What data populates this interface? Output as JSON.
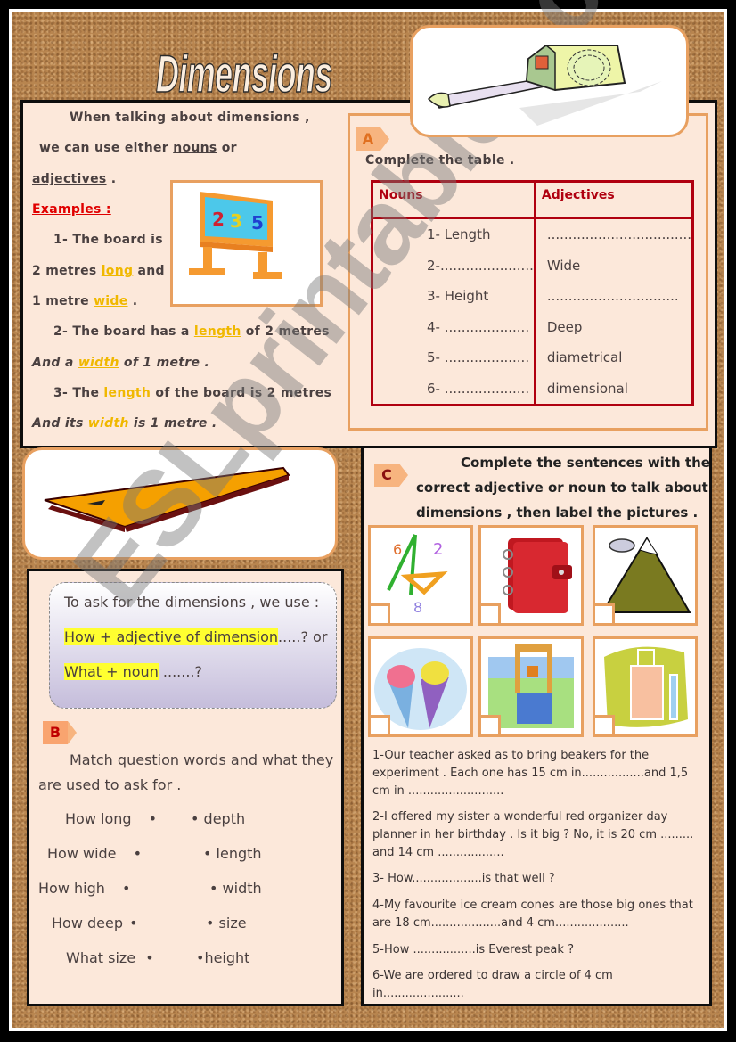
{
  "title": "Dimensions",
  "intro": {
    "line1": "When talking about dimensions ,",
    "line2_pre": "we can use either ",
    "line2_noun": "nouns",
    "line2_post": " or",
    "line3_adj": "adjectives",
    "line3_post": " .",
    "examples_label": "Examples :",
    "ex1_a": "1- The board is",
    "ex1_b_pre": "2 metres ",
    "ex1_b_kw": "long",
    "ex1_b_post": " and",
    "ex1_c_pre": "1 metre ",
    "ex1_c_kw": "wide",
    "ex1_c_post": " .",
    "ex2_a_pre": "2- The board has a ",
    "ex2_a_kw": "length",
    "ex2_a_post": " of 2 metres",
    "ex2_b_pre": "And a ",
    "ex2_b_kw": "width",
    "ex2_b_post": " of 1 metre .",
    "ex3_a_pre": "3- The ",
    "ex3_a_kw": "length",
    "ex3_a_post": " of the board is 2 metres",
    "ex3_b_pre": "And its ",
    "ex3_b_kw": "width",
    "ex3_b_post": " is 1 metre ."
  },
  "sectionA": {
    "tag": "A",
    "instruction": "Complete the table .",
    "headers": [
      "Nouns",
      "Adjectives"
    ],
    "nouns": [
      "1-  Length",
      "2-......................",
      "3-  Height",
      "4-  ....................",
      "5-  ....................",
      "6-  ...................."
    ],
    "adjectives": [
      "..................................",
      "Wide",
      "...............................",
      "Deep",
      "diametrical",
      "dimensional"
    ]
  },
  "sectionB": {
    "bubble_line1": "To ask for the dimensions , we use :",
    "bubble_line2_hl": "How + adjective of dimension",
    "bubble_line2_post": ".....?  or",
    "bubble_line3_hl": "What + noun",
    "bubble_line3_post": " .......?",
    "tag": "B",
    "instruction_line1": "Match question words and what they",
    "instruction_line2": "are used to ask for .",
    "left": [
      "How long",
      "How wide",
      "How high",
      "How deep",
      "What size"
    ],
    "right": [
      "depth",
      "length",
      "width",
      "size",
      "height"
    ]
  },
  "sectionC": {
    "tag": "C",
    "instruction_line1": "Complete the sentences with the",
    "instruction_line2": "correct adjective or noun to talk about",
    "instruction_line3": "dimensions , then label the pictures .",
    "pictures": [
      "geometry-tools",
      "red-planner",
      "mountain",
      "ice-cream-cones",
      "wishing-well",
      "beakers"
    ],
    "sentences": [
      "1-Our teacher asked as to bring  beakers for the experiment . Each one has 15 cm in.................and 1,5 cm in ..........................",
      "2-I offered my sister a wonderful red organizer day planner  in  her birthday . Is it big ? No, it is 20 cm ......... and 14 cm ..................",
      "3- How...................is that well ?",
      "4-My favourite ice cream cones are those big ones that are 18 cm...................and 4 cm....................",
      "5-How .................is Everest peak ?",
      "6-We are ordered to draw a circle of 4 cm in......................"
    ]
  },
  "watermark": "ESLprintables.com"
}
